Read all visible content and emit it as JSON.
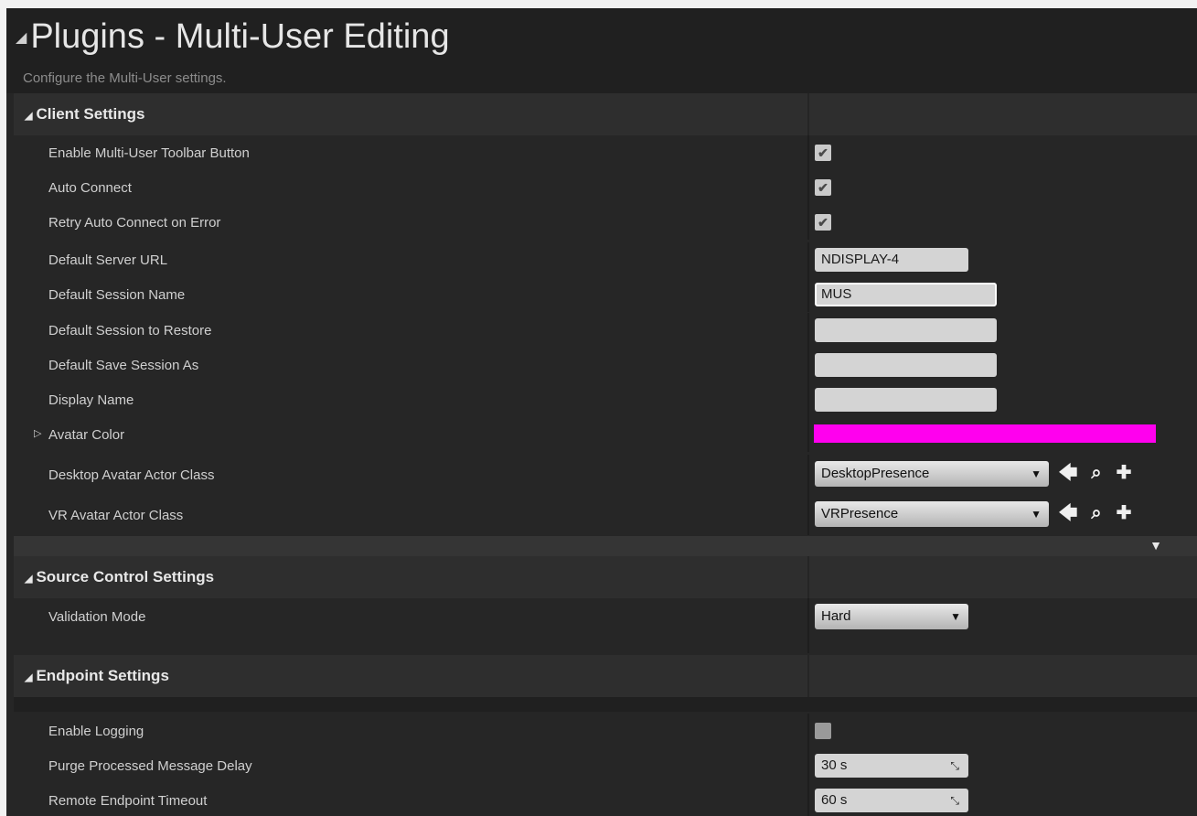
{
  "header": {
    "title": "Plugins - Multi-User Editing",
    "subtitle": "Configure the Multi-User settings."
  },
  "sections": {
    "client": {
      "label": "Client Settings",
      "rows": {
        "enable_toolbar": {
          "label": "Enable Multi-User Toolbar Button",
          "checked": true
        },
        "auto_connect": {
          "label": "Auto Connect",
          "checked": true
        },
        "retry_auto_connect": {
          "label": "Retry Auto Connect on Error",
          "checked": true
        },
        "default_server_url": {
          "label": "Default Server URL",
          "value": "NDISPLAY-4"
        },
        "default_session_name": {
          "label": "Default Session Name",
          "value": "MUS"
        },
        "default_session_restore": {
          "label": "Default Session to Restore",
          "value": ""
        },
        "default_save_session": {
          "label": "Default Save Session As",
          "value": ""
        },
        "display_name": {
          "label": "Display Name",
          "value": ""
        },
        "avatar_color": {
          "label": "Avatar Color",
          "color": "#ff00ee"
        },
        "desktop_avatar": {
          "label": "Desktop Avatar Actor Class",
          "value": "DesktopPresence"
        },
        "vr_avatar": {
          "label": "VR Avatar Actor Class",
          "value": "VRPresence"
        }
      }
    },
    "source_control": {
      "label": "Source Control Settings",
      "rows": {
        "validation_mode": {
          "label": "Validation Mode",
          "value": "Hard"
        }
      }
    },
    "endpoint": {
      "label": "Endpoint Settings",
      "rows": {
        "enable_logging": {
          "label": "Enable Logging",
          "checked": false
        },
        "purge_delay": {
          "label": "Purge Processed Message Delay",
          "value": "30 s"
        },
        "remote_timeout": {
          "label": "Remote Endpoint Timeout",
          "value": "60 s"
        }
      }
    }
  },
  "glyphs": {
    "collapse": "◢",
    "expand": "▷",
    "check": "✔",
    "dropdown": "▼",
    "advanced": "▼",
    "use_selected": "🡄",
    "browse": "⌕",
    "add": "✚",
    "spin": "⤡"
  },
  "colors": {
    "panel_bg": "#262626",
    "section_bg": "#2e2e2e",
    "avatar_color": "#ff00ee"
  }
}
